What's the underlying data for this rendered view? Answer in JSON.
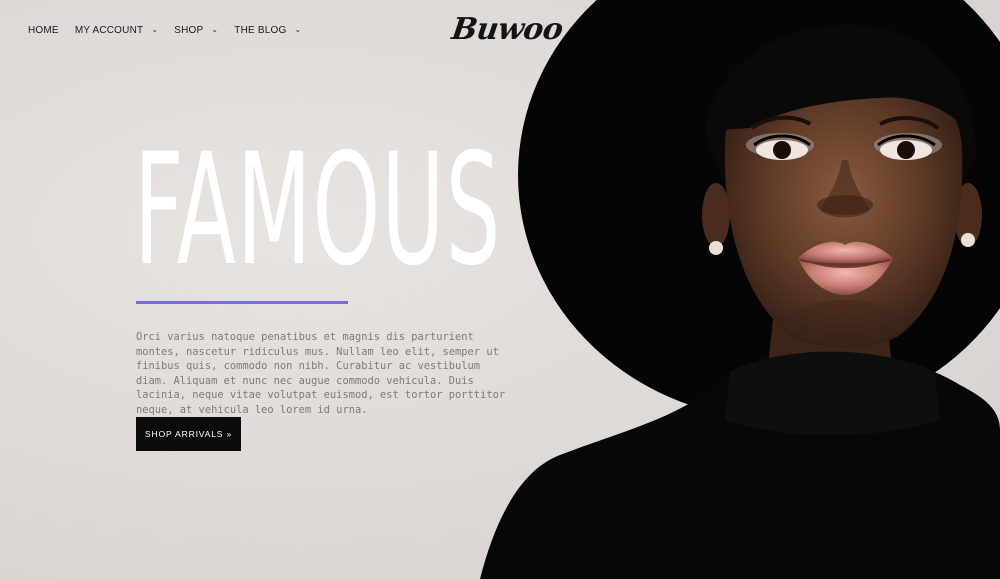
{
  "nav": {
    "items": [
      {
        "label": "HOME",
        "has_dropdown": false
      },
      {
        "label": "MY ACCOUNT",
        "has_dropdown": true
      },
      {
        "label": "SHOP",
        "has_dropdown": true
      },
      {
        "label": "THE BLOG",
        "has_dropdown": true
      }
    ]
  },
  "brand": {
    "logo_text": "Buwoo"
  },
  "hero": {
    "title": "FAMOUS",
    "body": "Orci varius natoque penatibus et magnis dis parturient montes, nascetur ridiculus mus. Nullam leo elit, semper ut finibus quis, commodo non nibh. Curabitur ac vestibulum diam. Aliquam et nunc nec augue commodo vehicula. Duis lacinia, neque vitae volutpat euismod, est tortor porttitor neque, at vehicula leo lorem id urna.",
    "cta_label": "SHOP ARRIVALS »"
  },
  "colors": {
    "accent": "#7b6bd6",
    "background": "#e3dfdc",
    "button": "#0b0b0b",
    "body_text": "#807a77"
  },
  "icons": {
    "dropdown": "chevron-down-icon"
  }
}
